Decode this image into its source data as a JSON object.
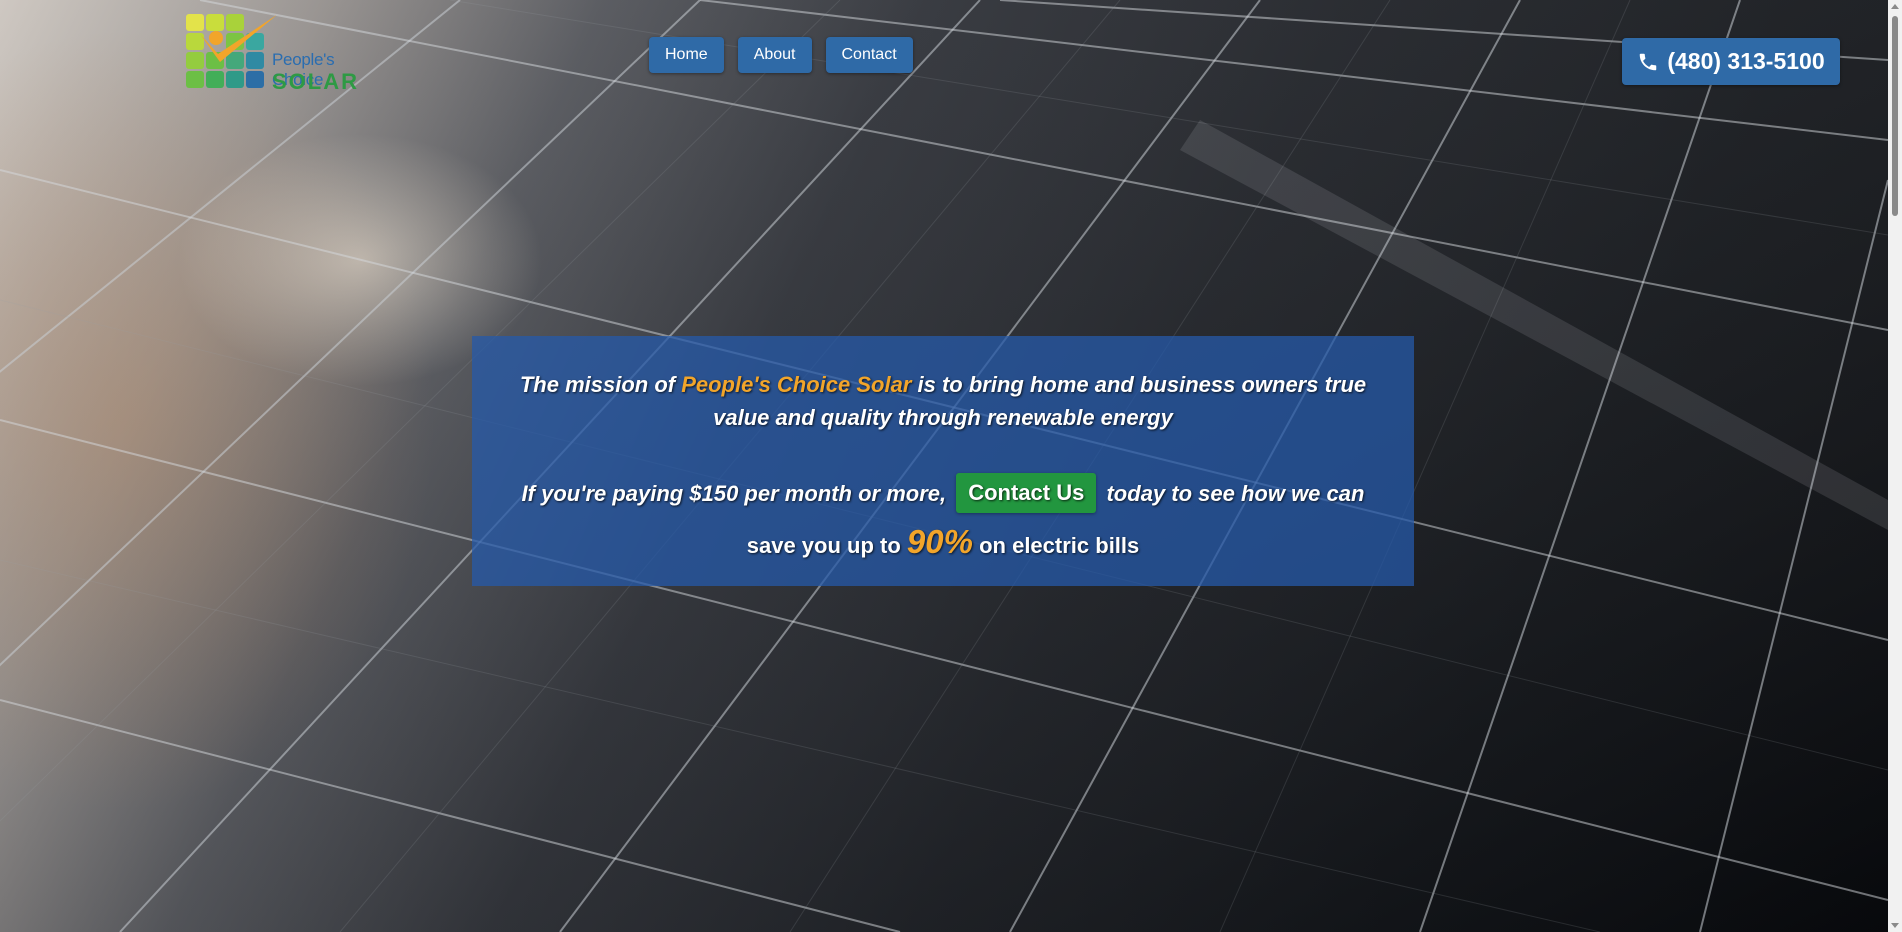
{
  "brand": {
    "name_line1": "People's Choice",
    "name_line2": "SOLAR",
    "colors": {
      "blue": "#2a6db0",
      "green": "#2e9a44",
      "accent": "#f2a52a"
    }
  },
  "nav": {
    "items": [
      {
        "label": "Home"
      },
      {
        "label": "About"
      },
      {
        "label": "Contact"
      }
    ]
  },
  "phone": {
    "icon": "phone-icon",
    "label": "(480) 313-5100"
  },
  "mission": {
    "prefix": "The mission of ",
    "brand_highlight": "People's Choice Solar",
    "suffix": " is to bring home and business owners true value and quality through renewable energy",
    "cta_prefix": "If you're paying $150 per month or more,",
    "cta_button": "Contact Us",
    "cta_suffix": "today to see how we can",
    "savings_prefix": "save you up to",
    "savings_value": "90%",
    "savings_suffix": "on electric bills"
  },
  "background": {
    "description_icon": "solar-panel-background"
  }
}
